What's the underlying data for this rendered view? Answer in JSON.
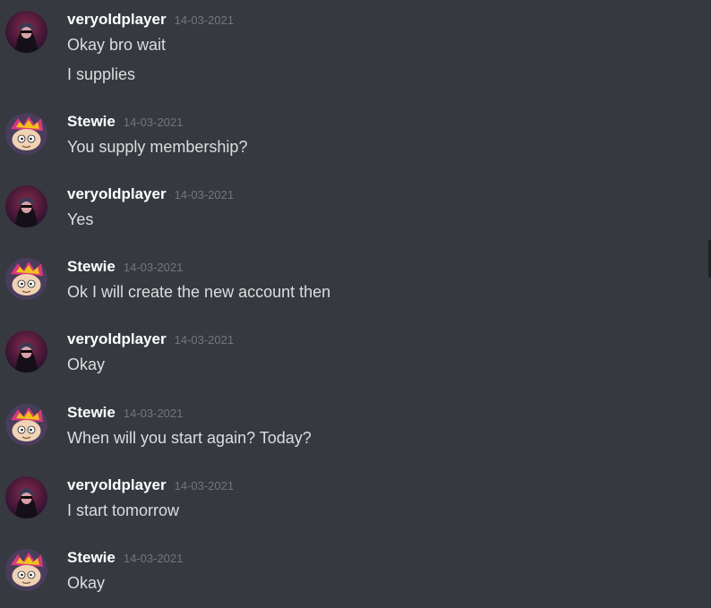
{
  "users": {
    "a": {
      "name": "veryoldplayer",
      "avatar_icon": "hooded-figure-avatar-icon"
    },
    "b": {
      "name": "Stewie",
      "avatar_icon": "stewie-cartoon-avatar-icon"
    }
  },
  "messages": [
    {
      "author": "veryoldplayer",
      "timestamp": "14-03-2021",
      "lines": [
        "Okay bro wait",
        "I supplies"
      ]
    },
    {
      "author": "Stewie",
      "timestamp": "14-03-2021",
      "lines": [
        "You supply membership?"
      ]
    },
    {
      "author": "veryoldplayer",
      "timestamp": "14-03-2021",
      "lines": [
        "Yes"
      ]
    },
    {
      "author": "Stewie",
      "timestamp": "14-03-2021",
      "lines": [
        "Ok I will create the new account then"
      ]
    },
    {
      "author": "veryoldplayer",
      "timestamp": "14-03-2021",
      "lines": [
        "Okay"
      ]
    },
    {
      "author": "Stewie",
      "timestamp": "14-03-2021",
      "lines": [
        "When will you start again? Today?"
      ]
    },
    {
      "author": "veryoldplayer",
      "timestamp": "14-03-2021",
      "lines": [
        "I start tomorrow"
      ]
    },
    {
      "author": "Stewie",
      "timestamp": "14-03-2021",
      "lines": [
        "Okay"
      ]
    }
  ],
  "colors": {
    "background": "#36393f",
    "author": "#ffffff",
    "timestamp": "#72767d",
    "text": "#dcddde"
  }
}
